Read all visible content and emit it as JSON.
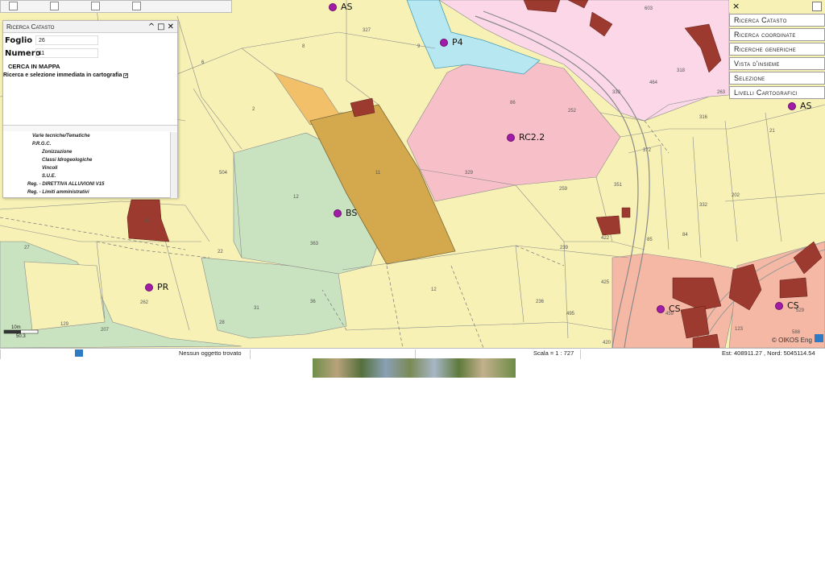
{
  "top_strip": {
    "checkboxes": 4
  },
  "panel": {
    "title": "Ricerca Catasto",
    "foglio_label": "Foglio",
    "foglio_value": "26",
    "numero_label": "Numero",
    "numero_value": "11",
    "cerca_label": "CERCA IN MAPPA",
    "checkbox_label": "Ricerca e selezione immediata in cartografia",
    "layers": [
      "Varie tecniche/Tematiche",
      "P.R.G.C.",
      "Zonizzazione",
      "Classi Idrogeologiche",
      "Vincoli",
      "S.U.E.",
      "Reg. - DIRETTIVA ALLUVIONI V15",
      "Reg. - Limiti amministrativi"
    ]
  },
  "right_menu": {
    "close": "×",
    "items": [
      "Ricerca Catasto",
      "Ricerca coordinate",
      "Ricerche generiche",
      "Vista d'insieme",
      "Selezione",
      "Livelli Cartografici"
    ]
  },
  "zones": [
    {
      "label": "AS",
      "id": "as-top"
    },
    {
      "label": "P4",
      "id": "p4"
    },
    {
      "label": "RC2.2",
      "id": "rc22"
    },
    {
      "label": "BS",
      "id": "bs"
    },
    {
      "label": "PR",
      "id": "pr"
    },
    {
      "label": "CS",
      "id": "cs1"
    },
    {
      "label": "CS",
      "id": "cs2"
    },
    {
      "label": "AS",
      "id": "as-right"
    }
  ],
  "parcels": [
    "327",
    "8",
    "9",
    "603",
    "6",
    "464",
    "318",
    "339",
    "2",
    "316",
    "263",
    "86",
    "252",
    "21",
    "504",
    "329",
    "259",
    "351",
    "372",
    "202",
    "332",
    "12",
    "85",
    "84",
    "11",
    "363",
    "422",
    "22",
    "27",
    "239",
    "425",
    "47",
    "262",
    "236",
    "495",
    "129",
    "31",
    "36",
    "207",
    "28",
    "12",
    "459",
    "529",
    "123",
    "588",
    "420"
  ],
  "scale_bar": {
    "label": "10m",
    "sub": "50.3"
  },
  "credit": "© OIKOS Eng",
  "status": {
    "message": "Nessun oggetto trovato",
    "scale": "Scala = 1 : 727",
    "coords": "Est: 408911.27 , Nord: 5045114.54"
  },
  "colors": {
    "map_bg": "#f7f1b5",
    "pink": "#f9c6cc",
    "green": "#c9e2c0",
    "brown": "#9d3a2f",
    "selected": "#d4a84c"
  }
}
